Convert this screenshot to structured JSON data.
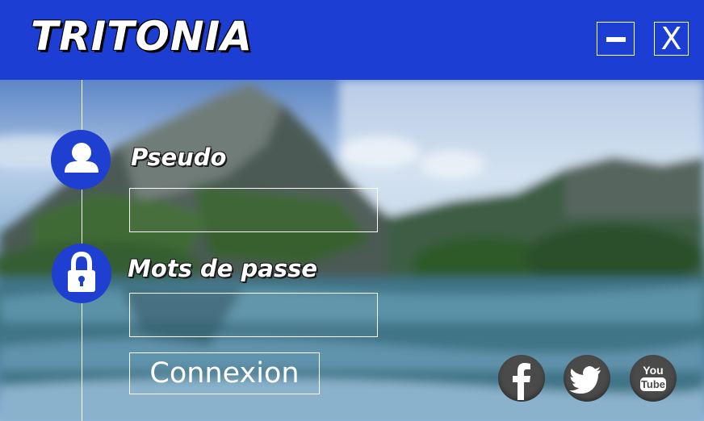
{
  "app": {
    "title": "TRITONIA"
  },
  "window_controls": {
    "minimize_label": "",
    "close_label": "X"
  },
  "login": {
    "pseudo_label": "Pseudo",
    "pseudo_value": "",
    "password_label": "Mots de passe",
    "password_value": "",
    "submit_label": "Connexion"
  },
  "icons": {
    "user": "user-icon",
    "lock": "lock-icon",
    "minimize": "minimize-icon",
    "close": "close-icon"
  },
  "social": [
    {
      "name": "facebook-icon"
    },
    {
      "name": "twitter-icon"
    },
    {
      "name": "youtube-icon",
      "text_top": "You",
      "text_bottom": "Tube"
    }
  ],
  "colors": {
    "header": "#1d3ed2",
    "circle": "#1f3fd0",
    "social": "#4a4a4a",
    "text": "#ffffff"
  }
}
